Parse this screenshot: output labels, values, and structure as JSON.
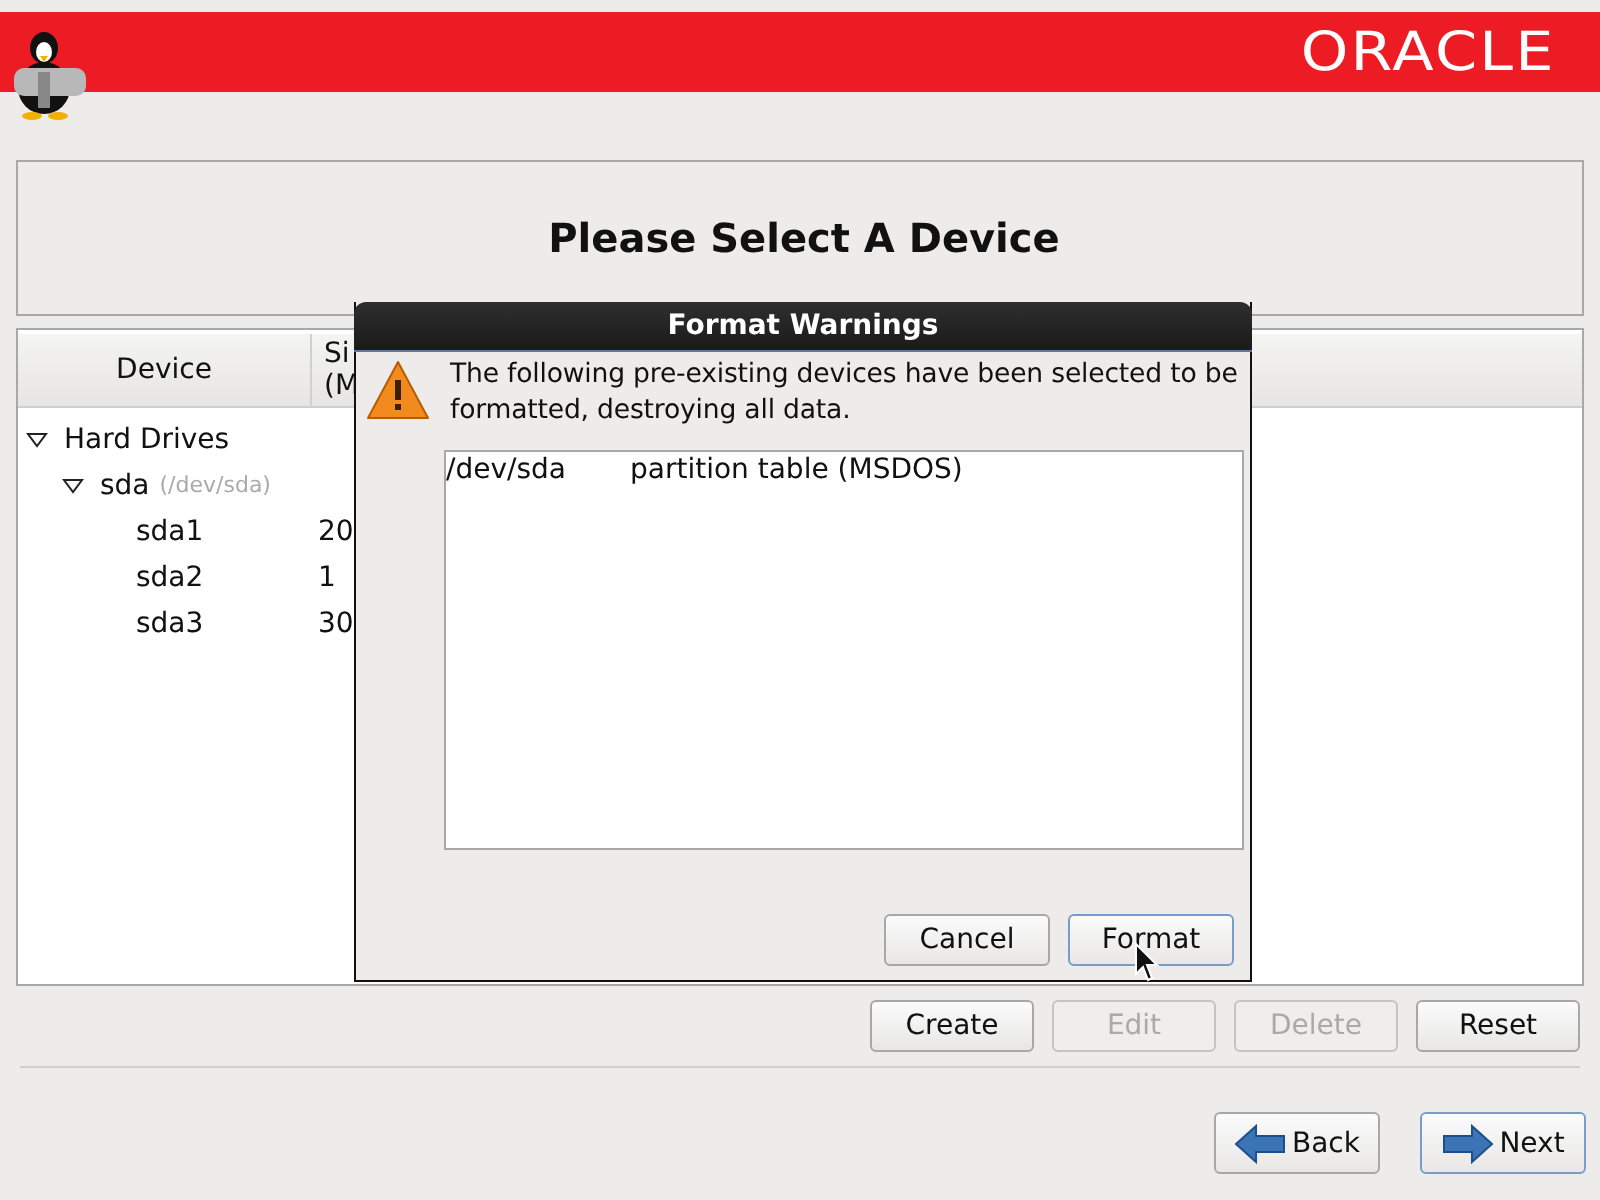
{
  "banner": {
    "brand": "ORACLE"
  },
  "heading": "Please Select A Device",
  "table": {
    "columns": [
      "Device",
      "Si\n(M"
    ],
    "tree": [
      {
        "label": "Hard Drives",
        "expanded": true,
        "children": [
          {
            "label": "sda",
            "path": "(/dev/sda)",
            "expanded": true,
            "children": [
              {
                "label": "sda1",
                "size": "20"
              },
              {
                "label": "sda2",
                "size": "1"
              },
              {
                "label": "sda3",
                "size": "30"
              }
            ]
          }
        ]
      }
    ]
  },
  "actions": [
    {
      "label": "Create",
      "disabled": false
    },
    {
      "label": "Edit",
      "disabled": true
    },
    {
      "label": "Delete",
      "disabled": true
    },
    {
      "label": "Reset",
      "disabled": false
    }
  ],
  "navigation": [
    {
      "label": "Back",
      "kind": "back",
      "default": false
    },
    {
      "label": "Next",
      "kind": "next",
      "default": true
    }
  ],
  "dialog": {
    "title": "Format Warnings",
    "message": "The following pre-existing devices have been selected to be formatted, destroying all data.",
    "devices": [
      {
        "device": "/dev/sda",
        "description": "partition table (MSDOS)"
      }
    ],
    "buttons": [
      {
        "label": "Cancel",
        "default": false
      },
      {
        "label": "Format",
        "default": true
      }
    ]
  }
}
